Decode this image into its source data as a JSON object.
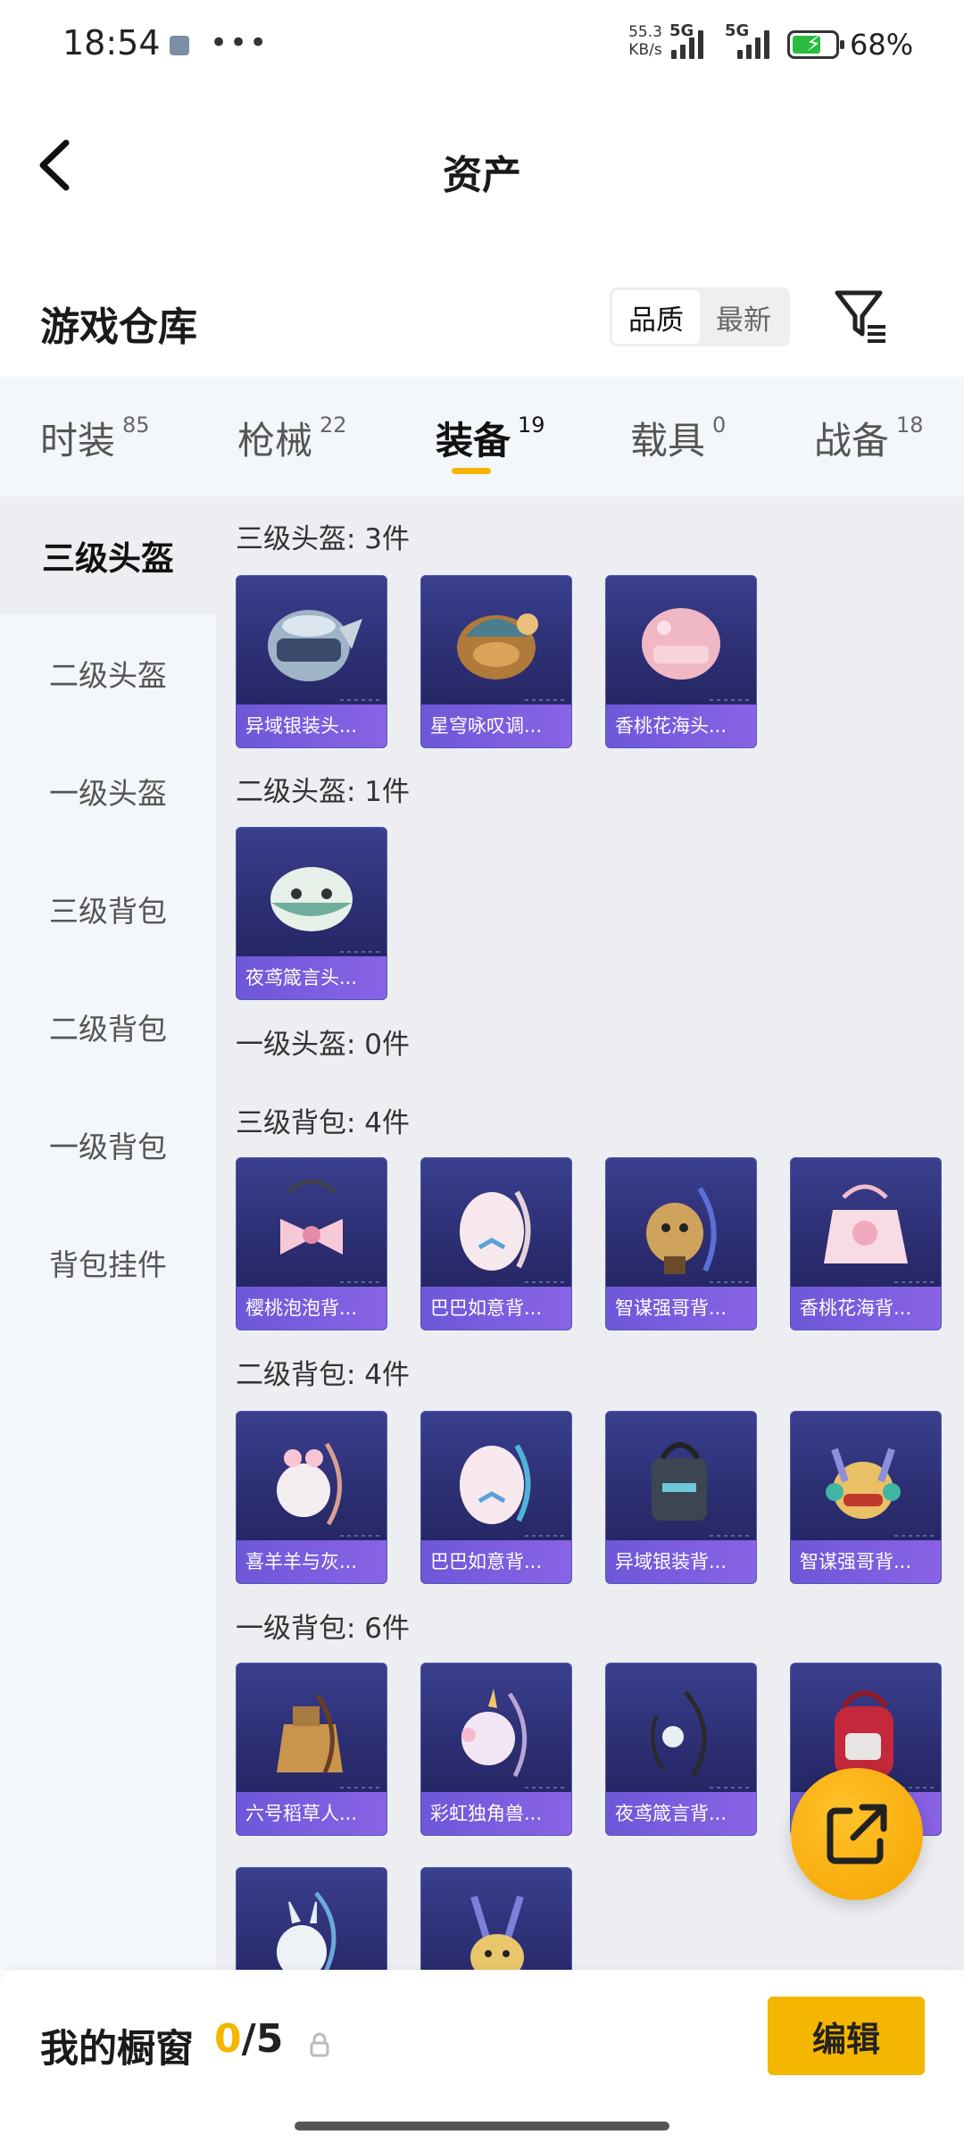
{
  "status_bar": {
    "time": "18:54",
    "more": "•••",
    "net_speed_value": "55.3",
    "net_speed_unit": "KB/s",
    "signal1_label": "5G",
    "signal2_label": "5G",
    "battery_level": 0.68,
    "battery_pct": "68%"
  },
  "header": {
    "title": "资产",
    "back_icon": "chevron-left-icon"
  },
  "warehouse": {
    "title": "游戏仓库",
    "sort_options": [
      "品质",
      "最新"
    ],
    "sort_selected": "品质",
    "filter_icon": "filter-icon"
  },
  "tabs": [
    {
      "label": "时装",
      "count": "85"
    },
    {
      "label": "枪械",
      "count": "22"
    },
    {
      "label": "装备",
      "count": "19",
      "active": true
    },
    {
      "label": "载具",
      "count": "0"
    },
    {
      "label": "战备",
      "count": "18"
    }
  ],
  "sidebar": {
    "items": [
      "三级头盔",
      "二级头盔",
      "一级头盔",
      "三级背包",
      "二级背包",
      "一级背包",
      "背包挂件"
    ],
    "active": "三级头盔"
  },
  "sections": [
    {
      "title": "三级头盔: 3件",
      "items": [
        "异域银装头...",
        "星穹咏叹调...",
        "香桃花海头..."
      ]
    },
    {
      "title": "二级头盔: 1件",
      "items": [
        "夜鸢箴言头..."
      ]
    },
    {
      "title": "一级头盔: 0件",
      "items": []
    },
    {
      "title": "三级背包: 4件",
      "items": [
        "樱桃泡泡背...",
        "巴巴如意背...",
        "智谋强哥背...",
        "香桃花海背..."
      ]
    },
    {
      "title": "二级背包: 4件",
      "items": [
        "喜羊羊与灰...",
        "巴巴如意背...",
        "异域银装背...",
        "智谋强哥背..."
      ]
    },
    {
      "title": "一级背包: 6件",
      "items": [
        "六号稻草人...",
        "彩虹独角兽...",
        "夜鸢箴言背...",
        "",
        "",
        ""
      ]
    }
  ],
  "colors": {
    "accent": "#f5b600",
    "card_label": "#7a5ee0",
    "card_bg": "#2a2c6e"
  },
  "showcase": {
    "label": "我的橱窗",
    "current": "0",
    "total": "/5",
    "edit_label": "编辑",
    "lock_icon": "lock-icon"
  },
  "share_icon": "share-external-icon"
}
